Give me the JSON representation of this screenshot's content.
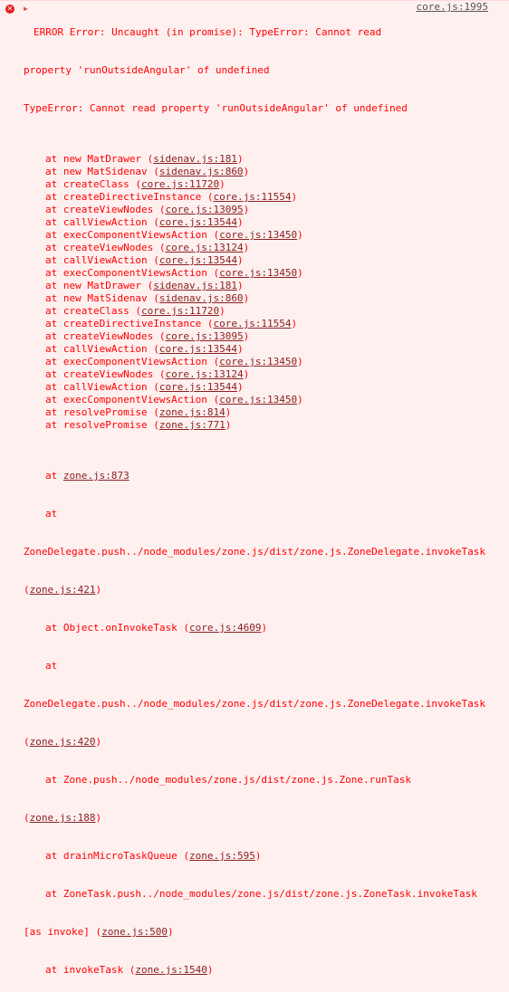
{
  "error": {
    "header_text": "ERROR Error: Uncaught (in promise): TypeError: Cannot read",
    "header_cont": "property 'runOutsideAngular' of undefined",
    "source_link": "core.js:1995",
    "type_error": "TypeError: Cannot read property 'runOutsideAngular' of undefined"
  },
  "stack": [
    {
      "fn": "new MatDrawer",
      "loc": "sidenav.js:181"
    },
    {
      "fn": "new MatSidenav",
      "loc": "sidenav.js:860"
    },
    {
      "fn": "createClass",
      "loc": "core.js:11720"
    },
    {
      "fn": "createDirectiveInstance",
      "loc": "core.js:11554"
    },
    {
      "fn": "createViewNodes",
      "loc": "core.js:13095"
    },
    {
      "fn": "callViewAction",
      "loc": "core.js:13544"
    },
    {
      "fn": "execComponentViewsAction",
      "loc": "core.js:13450"
    },
    {
      "fn": "createViewNodes",
      "loc": "core.js:13124"
    },
    {
      "fn": "callViewAction",
      "loc": "core.js:13544"
    },
    {
      "fn": "execComponentViewsAction",
      "loc": "core.js:13450"
    },
    {
      "fn": "new MatDrawer",
      "loc": "sidenav.js:181"
    },
    {
      "fn": "new MatSidenav",
      "loc": "sidenav.js:860"
    },
    {
      "fn": "createClass",
      "loc": "core.js:11720"
    },
    {
      "fn": "createDirectiveInstance",
      "loc": "core.js:11554"
    },
    {
      "fn": "createViewNodes",
      "loc": "core.js:13095"
    },
    {
      "fn": "callViewAction",
      "loc": "core.js:13544"
    },
    {
      "fn": "execComponentViewsAction",
      "loc": "core.js:13450"
    },
    {
      "fn": "createViewNodes",
      "loc": "core.js:13124"
    },
    {
      "fn": "callViewAction",
      "loc": "core.js:13544"
    },
    {
      "fn": "execComponentViewsAction",
      "loc": "core.js:13450"
    },
    {
      "fn": "resolvePromise",
      "loc": "zone.js:814"
    },
    {
      "fn": "resolvePromise",
      "loc": "zone.js:771"
    }
  ],
  "tail": {
    "at_prefix": "at ",
    "zone873": "zone.js:873",
    "zd_invoke_task": "ZoneDelegate.push../node_modules/zone.js/dist/zone.js.ZoneDelegate.invokeTask",
    "loc421": "zone.js:421",
    "object_on_invoke": "Object.onInvokeTask",
    "loc4609": "core.js:4609",
    "zd_invoke_task2": "ZoneDelegate.push../node_modules/zone.js/dist/zone.js.ZoneDelegate.invokeTask",
    "loc420": "zone.js:420",
    "zone_run_task": "Zone.push../node_modules/zone.js/dist/zone.js.Zone.runTask",
    "loc188": "zone.js:188",
    "drain": "drainMicroTaskQueue",
    "loc595": "zone.js:595",
    "zonetask_invoke": "ZoneTask.push../node_modules/zone.js/dist/zone.js.ZoneTask.invokeTask",
    "as_invoke": "[as invoke]",
    "loc500": "zone.js:500",
    "invoke_task": "invokeTask",
    "loc1540": "zone.js:1540"
  },
  "icons": {
    "error": "error-circle-icon",
    "expand": "triangle-right-icon"
  },
  "colors": {
    "background": "#fff0f0",
    "text": "#ff0000",
    "icon": "#e81b1b",
    "source_link": "#545454"
  }
}
